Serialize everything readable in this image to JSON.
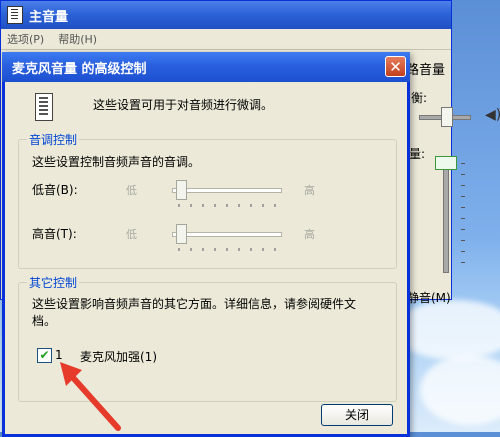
{
  "main_window": {
    "title": "主音量",
    "menu": [
      "选项(P)",
      "帮助(H)"
    ],
    "right_panel": {
      "title": "路音量",
      "balance_label": "衡:",
      "volume_label": "量:",
      "mute_label": "静音(M)"
    }
  },
  "dialog": {
    "title": "麦克风音量 的高级控制",
    "close_glyph": "✕",
    "intro": "这些设置可用于对音频进行微调。",
    "tone_group": {
      "label": "音调控制",
      "description": "这些设置控制音频声音的音调。",
      "bass": {
        "label": "低音(B):",
        "low": "低",
        "high": "高",
        "level": 0
      },
      "treble": {
        "label": "高音(T):",
        "low": "低",
        "high": "高",
        "level": 0
      }
    },
    "other_group": {
      "label": "其它控制",
      "description_line1": "这些设置影响音频声音的其它方面。详细信息，请参阅硬件文",
      "description_line2": "档。",
      "checkbox": {
        "number": "1",
        "label": "麦克风加强(1)",
        "checked": true,
        "check_glyph": "✔"
      }
    },
    "close_button": "关闭"
  },
  "colors": {
    "title_bar": "#2b62e0",
    "dialog_bg": "#ece9d8",
    "group_label": "#0046d5",
    "arrow": "#e63a2a"
  }
}
